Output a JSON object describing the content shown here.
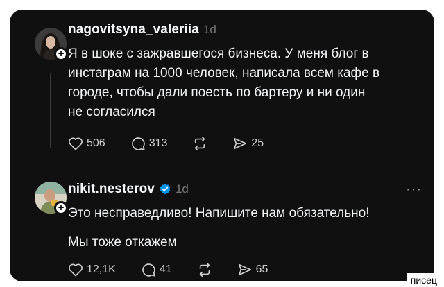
{
  "posts": [
    {
      "username": "nagovitsyna_valeriia",
      "time": "1d",
      "lines": [
        "Я в шоке с зажравшегося бизнеса. У меня блог в",
        "инстаграм на 1000 человек, написала всем кафе в",
        "городе, чтобы дали поесть по бартеру и ни один",
        "не согласился"
      ],
      "actions": {
        "likes": "506",
        "replies": "313",
        "shares": "25"
      }
    },
    {
      "username": "nikit.nesterov",
      "time": "1d",
      "verified": true,
      "lines": [
        "Это несправедливо! Напишите нам обязательно!",
        "",
        "Мы тоже откажем"
      ],
      "actions": {
        "likes": "12,1K",
        "replies": "41",
        "shares": "65"
      }
    }
  ],
  "watermark": "писец",
  "icons": [
    "plus-icon",
    "heart-icon",
    "comment-icon",
    "repost-icon",
    "share-icon",
    "verified-icon",
    "more-icon"
  ],
  "colors": {
    "background": "#101010",
    "text": "#f3f5f7",
    "muted": "#777777",
    "verified": "#0095f6"
  }
}
